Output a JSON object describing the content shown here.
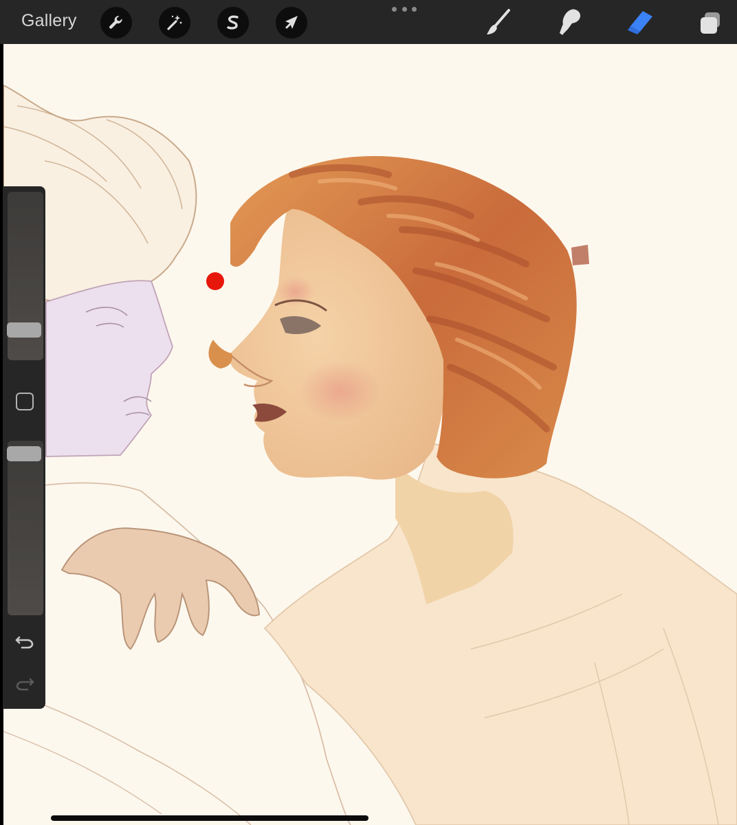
{
  "topbar": {
    "gallery_label": "Gallery",
    "left_tools": [
      {
        "icon": "wrench-icon",
        "name": "actions"
      },
      {
        "icon": "magic-wand-icon",
        "name": "adjustments"
      },
      {
        "icon": "selection-s-icon",
        "name": "selection"
      },
      {
        "icon": "arrow-cursor-icon",
        "name": "transform"
      }
    ],
    "more_icon": "more-dots-icon",
    "right_tools": [
      {
        "icon": "brush-icon",
        "name": "paint"
      },
      {
        "icon": "smudge-icon",
        "name": "smudge"
      },
      {
        "icon": "eraser-icon",
        "name": "erase",
        "active": true
      },
      {
        "icon": "layers-icon",
        "name": "layers"
      }
    ],
    "active_tool_color": "#3b82f6"
  },
  "sidebar": {
    "brush_size_level": 0.22,
    "opacity_level": 0.96,
    "modify_icon": "square-icon",
    "undo_icon": "undo-icon",
    "redo_icon": "redo-icon"
  },
  "canvas": {
    "background_color": "#fdf8ee",
    "color_dot": "#e8170c"
  }
}
